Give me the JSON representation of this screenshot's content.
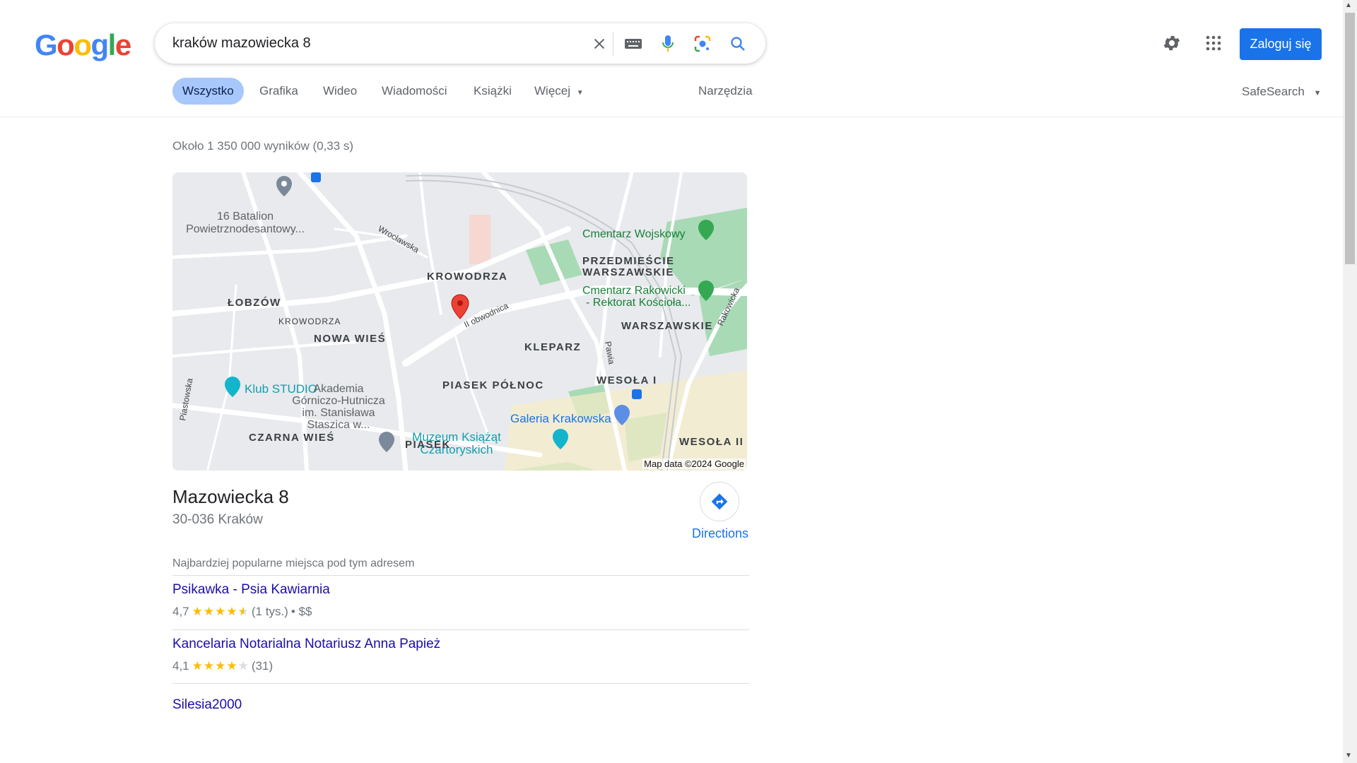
{
  "logo_text": "Google",
  "search": {
    "value": "kraków mazowiecka 8"
  },
  "icons": {
    "clear": "close-icon",
    "keyboard": "keyboard-icon",
    "voice": "mic-icon",
    "lens": "lens-icon",
    "search": "search-icon",
    "settings": "gear-icon",
    "apps": "apps-grid-icon"
  },
  "header": {
    "login_label": "Zaloguj się"
  },
  "tabs": [
    {
      "label": "Wszystko",
      "active": true
    },
    {
      "label": "Grafika"
    },
    {
      "label": "Wideo"
    },
    {
      "label": "Wiadomości"
    },
    {
      "label": "Książki"
    },
    {
      "label": "Więcej"
    }
  ],
  "tools_label": "Narzędzia",
  "safesearch_label": "SafeSearch",
  "result_stats": "Około 1 350 000 wyników (0,33 s)",
  "map": {
    "credit": "Map data ©2024 Google",
    "labels": {
      "batalion": "16 Batalion",
      "batalion2": "Powietrznodesantowy...",
      "wroclawska": "Wrocławska",
      "krowodrza": "KROWODRZA",
      "cmentarz_wojskowy": "Cmentarz Wojskowy",
      "przedmiescie": "PRZEDMIEŚCIE",
      "warszawskie_top": "WARSZAWSKIE",
      "lobzow": "ŁOBZÓW",
      "cmentarz_rakowicki": "Cmentarz Rakowicki",
      "rektorat": "- Rektorat Kościoła...",
      "rakowicka": "Rakowicka",
      "krowodrza_small": "KROWODRZA",
      "obwodnica": "II obwodnica",
      "warszawskie": "WARSZAWSKIE",
      "nowa_wies": "NOWA WIEŚ",
      "kleparz": "KLEPARZ",
      "pawia": "Pawia",
      "akademia1": "Akademia",
      "akademia2": "Górniczo-Hutnicza",
      "akademia3": "im. Stanisława",
      "akademia4": "Staszica w...",
      "piasek_polnoc": "PIASEK PÓŁNOC",
      "wesola_i": "WESOŁA I",
      "klub_studio": "Klub STUDIO",
      "piastowska": "Piastowska",
      "galeria": "Galeria Krakowska",
      "czarna_wies": "CZARNA WIEŚ",
      "piasek": "PIASEK",
      "muzeum1": "Muzeum Książąt",
      "muzeum2": "Czartoryskich",
      "wesola_ii": "WESOŁA II"
    }
  },
  "place": {
    "title": "Mazowiecka 8",
    "address": "30-036 Kraków",
    "directions_label": "Directions"
  },
  "popular": {
    "header": "Najbardziej popularne miejsca pod tym adresem",
    "items": [
      {
        "name": "Psikawka - Psia Kawiarnia",
        "rating": "4,7",
        "stars": 4.7,
        "count": "(1 tys.)",
        "price": "• $$"
      },
      {
        "name": "Kancelaria Notarialna Notariusz Anna Papież",
        "rating": "4,1",
        "stars": 4.1,
        "count": "(31)"
      },
      {
        "name": "Silesia2000"
      }
    ]
  }
}
